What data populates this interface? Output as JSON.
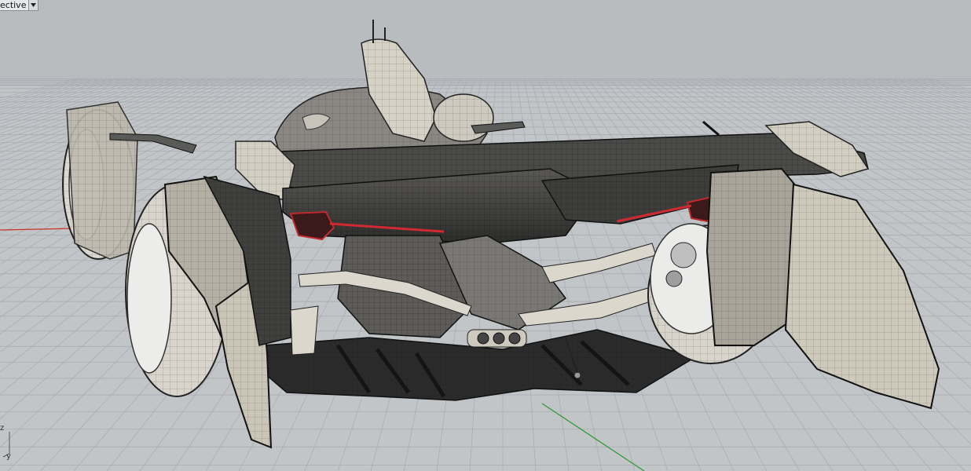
{
  "viewport": {
    "label": "ective",
    "axes": {
      "z": "z",
      "y": "y"
    },
    "colors": {
      "background": "#c2c5c8",
      "grid": "#a9adb2",
      "x_axis": "#c8312b",
      "y_axis": "#2f9a3a",
      "accent_light": "#cf2a31"
    }
  }
}
